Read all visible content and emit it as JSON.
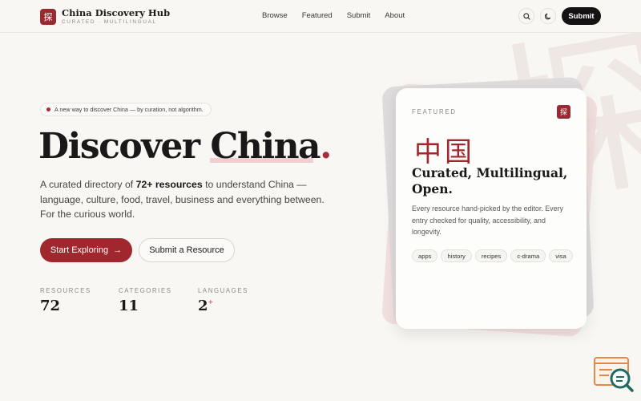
{
  "background": {
    "glyph": "探"
  },
  "brand": {
    "mark": "探",
    "title": "China Discovery Hub",
    "subtitle": "CURATED · MULTILINGUAL"
  },
  "nav": {
    "items": [
      {
        "label": "Browse"
      },
      {
        "label": "Featured"
      },
      {
        "label": "Submit"
      },
      {
        "label": "About"
      }
    ]
  },
  "header_actions": {
    "search_icon": "search-icon",
    "theme_icon": "moon-icon",
    "submit_label": "Submit"
  },
  "hero": {
    "pill_text": "A new way to discover China — by curation, not algorithm.",
    "title_part1": "Discover ",
    "title_accent": "China",
    "title_period": ".",
    "desc_before": "A curated directory of ",
    "desc_bold": "72+ resources",
    "desc_after": " to understand China — language, culture, food, travel, business and everything between. For the curious world.",
    "primary_button": "Start Exploring",
    "primary_button_icon": "→",
    "secondary_button": "Submit a Resource"
  },
  "stats": [
    {
      "label": "RESOURCES",
      "value": "72",
      "suffix": ""
    },
    {
      "label": "CATEGORIES",
      "value": "11",
      "suffix": ""
    },
    {
      "label": "LANGUAGES",
      "value": "2",
      "suffix": "+"
    }
  ],
  "featured_card": {
    "label": "FEATURED",
    "mark": "探",
    "hanzi": "中国",
    "title": "Curated, Multilingual, Open.",
    "description": "Every resource hand-picked by the editor. Every entry checked for quality, accessibility, and longevity.",
    "tags": [
      "apps",
      "history",
      "recipes",
      "c-drama",
      "visa"
    ]
  },
  "colors": {
    "accent": "#a1272f",
    "background": "#f8f7f4",
    "dark": "#141213"
  }
}
